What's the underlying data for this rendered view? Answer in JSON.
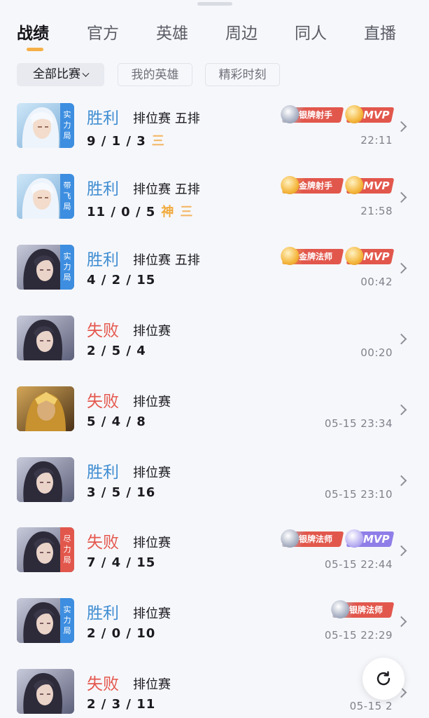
{
  "tabs": [
    {
      "label": "战绩",
      "active": true
    },
    {
      "label": "官方",
      "active": false
    },
    {
      "label": "英雄",
      "active": false
    },
    {
      "label": "周边",
      "active": false
    },
    {
      "label": "同人",
      "active": false
    },
    {
      "label": "直播",
      "active": false
    }
  ],
  "filters": [
    {
      "label": "全部比赛",
      "active": true,
      "icon": "chevron-down-icon"
    },
    {
      "label": "我的英雄",
      "active": false
    },
    {
      "label": "精彩时刻",
      "active": false
    }
  ],
  "colors": {
    "win": "#3f8dd1",
    "lose": "#e4574d",
    "accent": "#f5b04a",
    "tag_blue": "#3d8ee0",
    "tag_red": "#e2574c",
    "badge_red": "#e2574c",
    "badge_purple": "#8f7ee8"
  },
  "matches": [
    {
      "hero": "white-hair-hero",
      "tag": "实力局",
      "result": "胜利",
      "outcome": "win",
      "mode": "排位赛 五排",
      "kda": "9 / 1 / 3",
      "kda_badges": [
        "三"
      ],
      "time": "22:11",
      "badges": [
        {
          "text": "银牌射手",
          "kind": "silver"
        },
        {
          "text": "MVP",
          "kind": "mvp-red"
        }
      ]
    },
    {
      "hero": "white-hair-hero",
      "tag": "带飞局",
      "result": "胜利",
      "outcome": "win",
      "mode": "排位赛 五排",
      "kda": "11 / 0 / 5",
      "kda_badges": [
        "神",
        "三"
      ],
      "time": "21:58",
      "badges": [
        {
          "text": "金牌射手",
          "kind": "gold"
        },
        {
          "text": "MVP",
          "kind": "mvp-red"
        }
      ]
    },
    {
      "hero": "dark-hair-hero",
      "tag": "实力局",
      "result": "胜利",
      "outcome": "win",
      "mode": "排位赛 五排",
      "kda": "4 / 2 / 15",
      "kda_badges": [],
      "time": "00:42",
      "badges": [
        {
          "text": "金牌法师",
          "kind": "gold"
        },
        {
          "text": "MVP",
          "kind": "mvp-red"
        }
      ]
    },
    {
      "hero": "dark-hair-hero",
      "tag": "",
      "result": "失败",
      "outcome": "lose",
      "mode": "排位赛",
      "kda": "2 / 5 / 4",
      "kda_badges": [],
      "time": "00:20",
      "badges": []
    },
    {
      "hero": "golden-armor-hero",
      "tag": "",
      "result": "失败",
      "outcome": "lose",
      "mode": "排位赛",
      "kda": "5 / 4 / 8",
      "kda_badges": [],
      "time": "05-15 23:34",
      "badges": []
    },
    {
      "hero": "dark-hair-hero",
      "tag": "",
      "result": "胜利",
      "outcome": "win",
      "mode": "排位赛",
      "kda": "3 / 5 / 16",
      "kda_badges": [],
      "time": "05-15 23:10",
      "badges": []
    },
    {
      "hero": "dark-hair-hero",
      "tag": "尽力局",
      "result": "失败",
      "outcome": "lose",
      "mode": "排位赛",
      "kda": "7 / 4 / 15",
      "kda_badges": [],
      "time": "05-15 22:44",
      "badges": [
        {
          "text": "银牌法师",
          "kind": "silver"
        },
        {
          "text": "MVP",
          "kind": "mvp-purple"
        }
      ]
    },
    {
      "hero": "dark-hair-hero",
      "tag": "实力局",
      "result": "胜利",
      "outcome": "win",
      "mode": "排位赛",
      "kda": "2 / 0 / 10",
      "kda_badges": [],
      "time": "05-15 22:29",
      "badges": [
        {
          "text": "银牌法师",
          "kind": "silver"
        }
      ]
    },
    {
      "hero": "dark-hair-hero",
      "tag": "",
      "result": "失败",
      "outcome": "lose",
      "mode": "排位赛",
      "kda": "2 / 3 / 11",
      "kda_badges": [],
      "time": "05-15 2",
      "badges": []
    }
  ],
  "refresh": {
    "icon": "refresh-icon"
  }
}
